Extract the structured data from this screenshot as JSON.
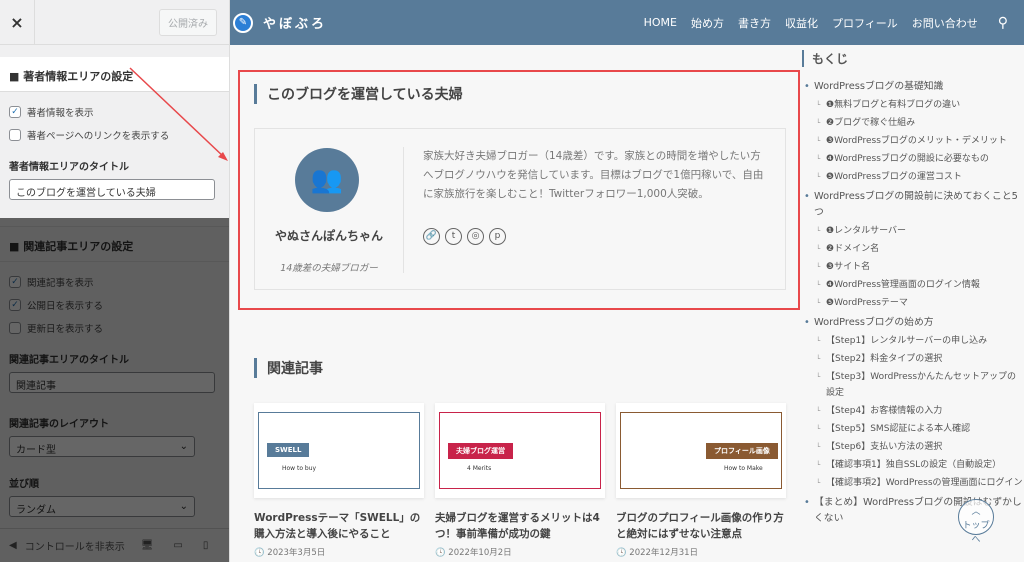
{
  "customizer": {
    "close_label": "×",
    "publish_label": "公開済み",
    "author_section": {
      "title": "著者情報エリアの設定",
      "options": [
        {
          "label": "著者情報を表示",
          "checked": true
        },
        {
          "label": "著者ページへのリンクを表示する",
          "checked": false
        }
      ],
      "title_label": "著者情報エリアのタイトル",
      "title_value": "このブログを運営している夫婦"
    },
    "related_section": {
      "title": "関連記事エリアの設定",
      "options": [
        {
          "label": "関連記事を表示",
          "checked": true
        },
        {
          "label": "公開日を表示する",
          "checked": true
        },
        {
          "label": "更新日を表示する",
          "checked": false
        }
      ],
      "title_label": "関連記事エリアのタイトル",
      "title_value": "関連記事",
      "layout_label": "関連記事のレイアウト",
      "layout_value": "カード型",
      "order_label": "並び順",
      "order_value": "ランダム"
    },
    "footer": {
      "hide_controls": "コントロールを非表示"
    }
  },
  "site": {
    "logo": "やぼぶろ",
    "nav": [
      "HOME",
      "始め方",
      "書き方",
      "収益化",
      "プロフィール",
      "お問い合わせ"
    ],
    "author_box": {
      "title": "このブログを運営している夫婦",
      "name": "やぬさんぽんちゃん",
      "subtitle": "14歳差の夫婦ブロガー",
      "description": "家族大好き夫婦ブロガー（14歳差）です。家族との時間を増やしたい方へブログノウハウを発信しています。目標はブログで1億円稼いで、自由に家族旅行を楽しむこと！Twitterフォロワー1,000人突破。",
      "social_icons": [
        "link-icon",
        "twitter-icon",
        "instagram-icon",
        "pinterest-icon"
      ]
    },
    "related": {
      "title": "関連記事",
      "posts": [
        {
          "title": "WordPressテーマ「SWELL」の購入方法と導入後にやること",
          "date": "2023年3月5日",
          "tag": "SWELL",
          "sub": "How to buy",
          "color": "#587b99"
        },
        {
          "title": "夫婦ブログを運営するメリットは4つ！事前準備が成功の鍵",
          "date": "2022年10月2日",
          "tag": "夫婦ブログ運営",
          "sub": "4 Merits",
          "color": "#c8234a"
        },
        {
          "title": "ブログのプロフィール画像の作り方と絶対にはずせない注意点",
          "date": "2022年12月31日",
          "tag": "プロフィール画像",
          "sub": "How to Make",
          "color": "#8a5a32"
        }
      ]
    },
    "toc": {
      "title": "もくじ",
      "sections": [
        {
          "label": "WordPressブログの基礎知識",
          "items": [
            "❶無料ブログと有料ブログの違い",
            "❷ブログで稼ぐ仕組み",
            "❸WordPressブログのメリット・デメリット",
            "❹WordPressブログの開設に必要なもの",
            "❺WordPressブログの運営コスト"
          ]
        },
        {
          "label": "WordPressブログの開設前に決めておくこと5つ",
          "items": [
            "❶レンタルサーバー",
            "❷ドメイン名",
            "❸サイト名",
            "❹WordPress管理画面のログイン情報",
            "❺WordPressテーマ"
          ]
        },
        {
          "label": "WordPressブログの始め方",
          "items": [
            "【Step1】レンタルサーバーの申し込み",
            "【Step2】料金タイプの選択",
            "【Step3】WordPressかんたんセットアップの設定",
            "【Step4】お客様情報の入力",
            "【Step5】SMS認証による本人確認",
            "【Step6】支払い方法の選択",
            "【確認事項1】独自SSLの設定（自動設定）",
            "【確認事項2】WordPressの管理画面にログイン"
          ]
        },
        {
          "label": "【まとめ】WordPressブログの開設はむずかしくない",
          "items": []
        }
      ]
    },
    "back_to_top": "トップへ"
  },
  "colors": {
    "header": "#587b99",
    "highlight": "#e8484b"
  }
}
